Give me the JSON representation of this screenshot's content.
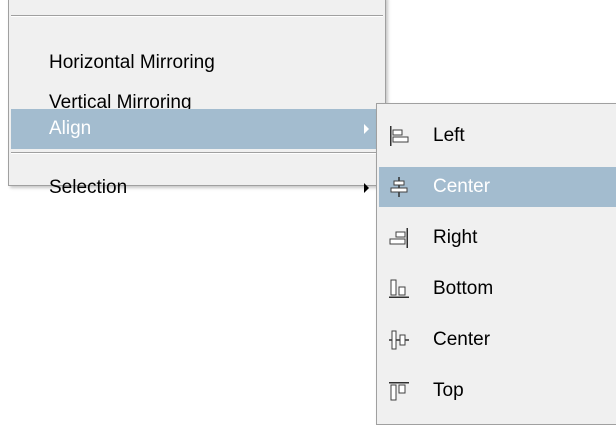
{
  "main_menu": {
    "items": [
      {
        "label": "Horizontal Mirroring"
      },
      {
        "label": "Vertical Mirroring"
      },
      {
        "label": "Align"
      },
      {
        "label": "Selection"
      }
    ]
  },
  "align_submenu": {
    "items": [
      {
        "label": "Left",
        "icon": "align-left-icon"
      },
      {
        "label": "Center",
        "icon": "align-horizontal-center-icon"
      },
      {
        "label": "Right",
        "icon": "align-right-icon"
      },
      {
        "label": "Bottom",
        "icon": "align-bottom-icon"
      },
      {
        "label": "Center",
        "icon": "align-vertical-center-icon"
      },
      {
        "label": "Top",
        "icon": "align-top-icon"
      }
    ]
  },
  "colors": {
    "menu_background": "#f0f0f0",
    "highlight": "#a3bccf",
    "border": "#a0a0a0"
  }
}
